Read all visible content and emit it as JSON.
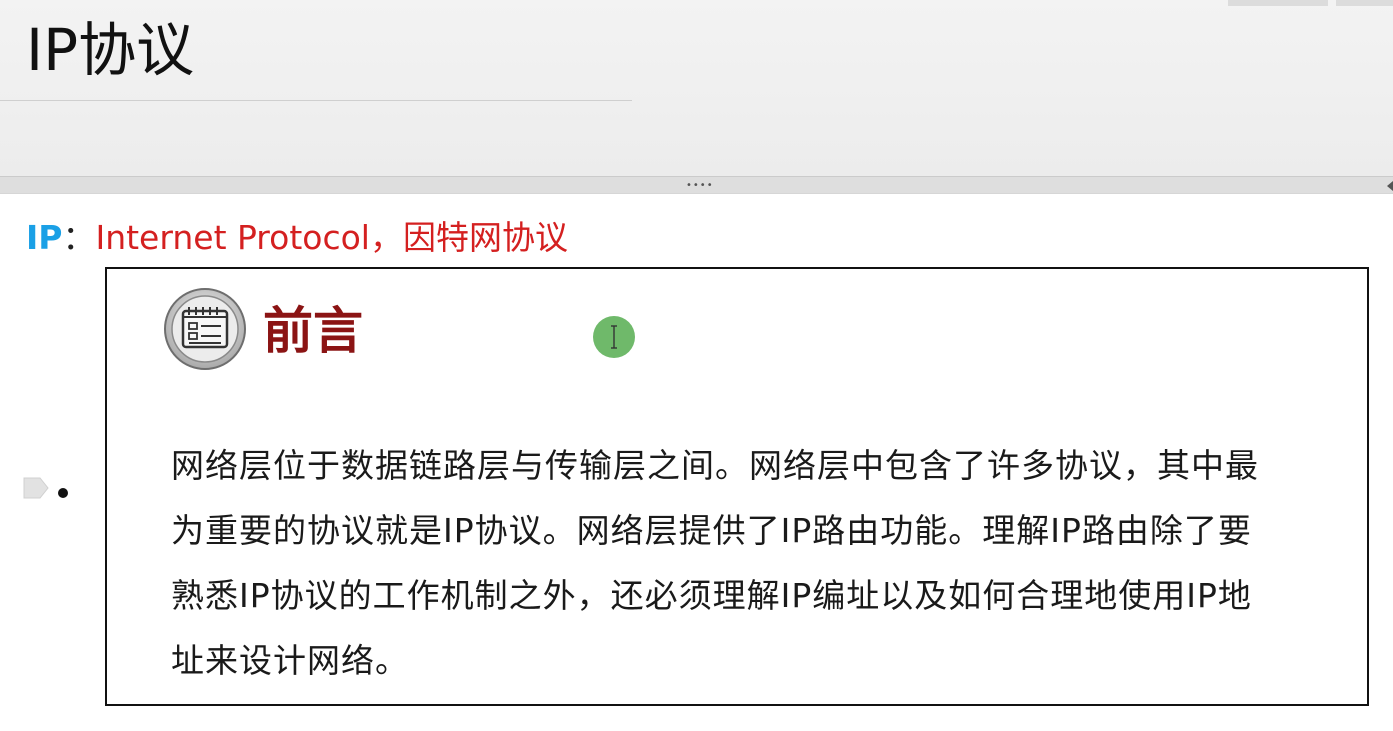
{
  "slide": {
    "title": "IP协议"
  },
  "content": {
    "ip_tag": "IP",
    "ip_colon": "：",
    "ip_description": "Internet Protocol，因特网协议"
  },
  "preface": {
    "heading": "前言",
    "lines": [
      "网络层位于数据链路层与传输层之间。网络层中包含了许多协议，其中最",
      "为重要的协议就是IP协议。网络层提供了IP路由功能。理解IP路由除了要",
      "熟悉IP协议的工作机制之外，还必须理解IP编址以及如何合理地使用IP地",
      "址来设计网络。"
    ]
  },
  "ui": {
    "splitter_grip": "••••"
  },
  "colors": {
    "ip_tag": "#1aa0e6",
    "ip_description": "#d42020",
    "preface_heading": "#8b1414",
    "cursor_highlight": "#6fb96a"
  },
  "icons": {
    "preface": "notepad-icon",
    "cursor": "text-cursor-icon",
    "bullet": "tag-shape-icon"
  }
}
